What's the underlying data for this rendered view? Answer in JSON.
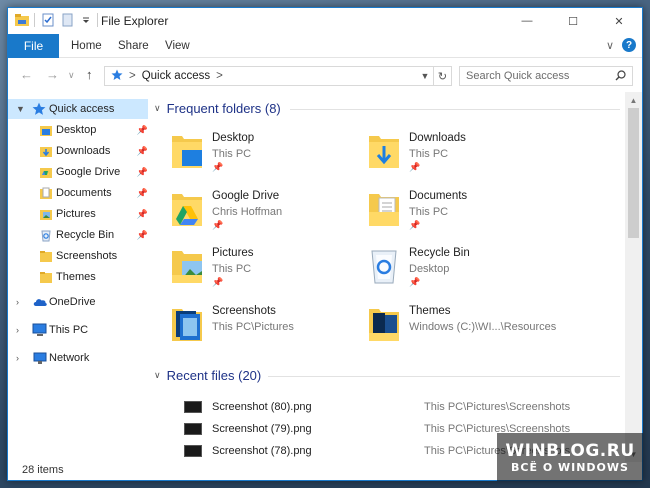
{
  "window": {
    "title": "File Explorer"
  },
  "window_buttons": {
    "minimize": "—",
    "maximize": "☐",
    "close": "✕"
  },
  "ribbon": {
    "file_tab": "File",
    "tabs": [
      "Home",
      "Share",
      "View"
    ],
    "expand_glyph": "∨",
    "help_glyph": "?"
  },
  "address": {
    "back": "←",
    "forward": "→",
    "recent_dropdown": "∨",
    "up": "↑",
    "location": "Quick access",
    "sep1": ">",
    "sep2": ">",
    "refresh_glyph": "↻"
  },
  "search": {
    "placeholder": "Search Quick access"
  },
  "sidebar": {
    "quick_access": "Quick access",
    "pinned": [
      {
        "label": "Desktop",
        "pinned": true
      },
      {
        "label": "Downloads",
        "pinned": true
      },
      {
        "label": "Google Drive",
        "pinned": true
      },
      {
        "label": "Documents",
        "pinned": true
      },
      {
        "label": "Pictures",
        "pinned": true
      },
      {
        "label": "Recycle Bin",
        "pinned": true
      },
      {
        "label": "Screenshots",
        "pinned": false
      },
      {
        "label": "Themes",
        "pinned": false
      }
    ],
    "onedrive": "OneDrive",
    "this_pc": "This PC",
    "network": "Network"
  },
  "frequent": {
    "header": "Frequent folders (8)",
    "folders": [
      {
        "name": "Desktop",
        "location": "This PC",
        "pinned": true
      },
      {
        "name": "Downloads",
        "location": "This PC",
        "pinned": true
      },
      {
        "name": "Google Drive",
        "location": "Chris Hoffman",
        "pinned": true
      },
      {
        "name": "Documents",
        "location": "This PC",
        "pinned": true
      },
      {
        "name": "Pictures",
        "location": "This PC",
        "pinned": true
      },
      {
        "name": "Recycle Bin",
        "location": "Desktop",
        "pinned": true
      },
      {
        "name": "Screenshots",
        "location": "This PC\\Pictures",
        "pinned": false
      },
      {
        "name": "Themes",
        "location": "Windows (C:)\\WI...\\Resources",
        "pinned": false
      }
    ]
  },
  "recent": {
    "header": "Recent files (20)",
    "files": [
      {
        "name": "Screenshot (80).png",
        "path": "This PC\\Pictures\\Screenshots"
      },
      {
        "name": "Screenshot (79).png",
        "path": "This PC\\Pictures\\Screenshots"
      },
      {
        "name": "Screenshot (78).png",
        "path": "This PC\\Pictures\\Screenshots"
      }
    ]
  },
  "status": {
    "items": "28 items"
  },
  "watermark": {
    "line1": "WINBLOG.RU",
    "line2": "ВСЁ О WINDOWS"
  },
  "colors": {
    "accent": "#1979ca",
    "group_header": "#1e3287",
    "selected": "#cce8ff",
    "folder": "#f5c94c"
  }
}
